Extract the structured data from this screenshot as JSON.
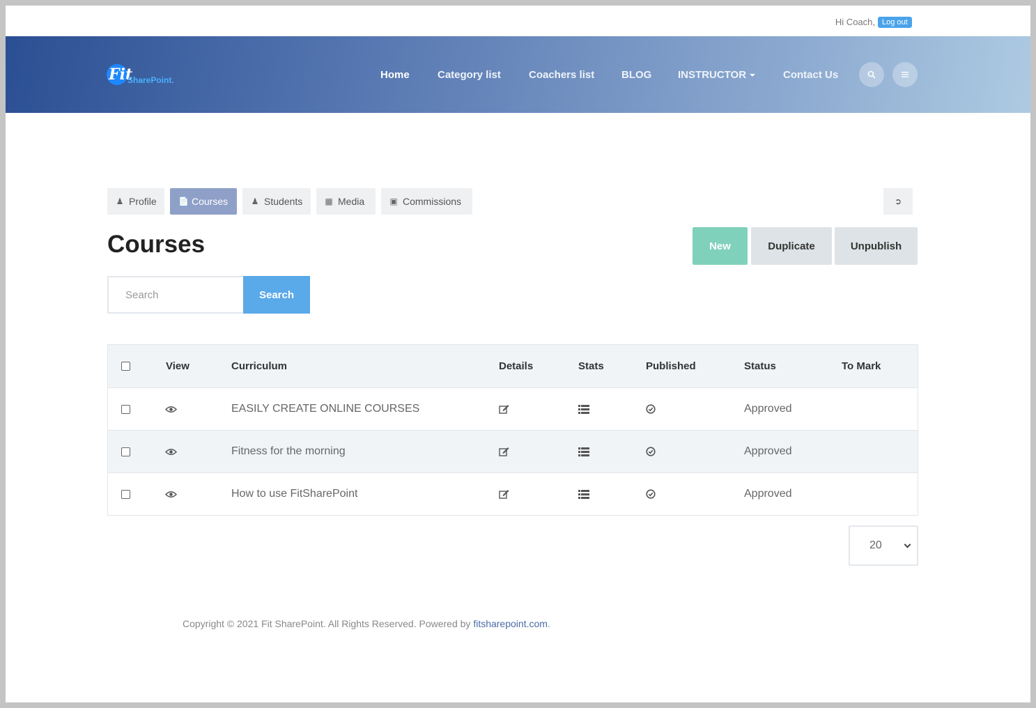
{
  "topbar": {
    "greeting": "Hi Coach,",
    "logout_label": "Log out"
  },
  "brand": {
    "logo_fit": "Fit",
    "logo_sharepoint": "SharePoint."
  },
  "nav": {
    "home": "Home",
    "category_list": "Category list",
    "coachers_list": "Coachers list",
    "blog": "BLOG",
    "instructor": "INSTRUCTOR",
    "contact": "Contact Us"
  },
  "tabs": {
    "profile": "Profile",
    "courses": "Courses",
    "students": "Students",
    "media": "Media",
    "commissions": "Commissions"
  },
  "page_title": "Courses",
  "actions": {
    "new": "New",
    "duplicate": "Duplicate",
    "unpublish": "Unpublish"
  },
  "search": {
    "placeholder": "Search",
    "button": "Search"
  },
  "table": {
    "headers": {
      "view": "View",
      "curriculum": "Curriculum",
      "details": "Details",
      "stats": "Stats",
      "published": "Published",
      "status": "Status",
      "to_mark": "To Mark"
    },
    "rows": [
      {
        "curriculum": "EASILY CREATE ONLINE COURSES",
        "status": "Approved"
      },
      {
        "curriculum": "Fitness for the morning",
        "status": "Approved"
      },
      {
        "curriculum": "How to use FitSharePoint",
        "status": "Approved"
      }
    ]
  },
  "pager": {
    "per_page": "20"
  },
  "footer": {
    "text": "Copyright © 2021 Fit SharePoint. All Rights Reserved. Powered by ",
    "link": "fitsharepoint.com",
    "end": "."
  },
  "colors": {
    "accent_blue": "#5aa9e9",
    "new_button": "#7fd1bb",
    "active_tab": "#8fa0c8"
  }
}
